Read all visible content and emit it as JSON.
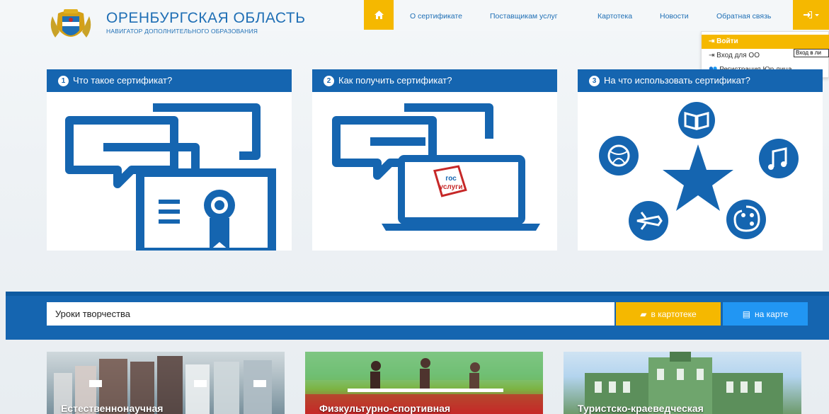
{
  "header": {
    "title": "ОРЕНБУРГСКАЯ ОБЛАСТЬ",
    "subtitle": "НАВИГАТОР ДОПОЛНИТЕЛЬНОГО ОБРАЗОВАНИЯ",
    "home_icon": "home-icon",
    "nav": [
      {
        "label": "О сертификате"
      },
      {
        "label": "Поставщикам услуг"
      },
      {
        "label": "Картотека"
      },
      {
        "label": "Новости"
      },
      {
        "label": "Обратная связь"
      }
    ],
    "login_icon": "sign-in-icon"
  },
  "login_menu": {
    "items": [
      {
        "label": "Войти",
        "icon": "sign-in-icon"
      },
      {
        "label": "Вход для ОО",
        "icon": "sign-in-icon"
      },
      {
        "label": "Регистрация Юр.лица",
        "icon": "user-add-icon"
      }
    ],
    "tooltip": "Вход в ли"
  },
  "cards": [
    {
      "num": "1",
      "title": "Что такое сертификат?"
    },
    {
      "num": "2",
      "title": "Как получить сертификат?",
      "logo_text_1": "гос",
      "logo_text_2": "услуги"
    },
    {
      "num": "3",
      "title": "На что использовать сертификат?"
    }
  ],
  "search": {
    "value": "Уроки творчества",
    "catalog_button": "в картотеке",
    "map_button": "на карте"
  },
  "categories": [
    {
      "label": "Естественнонаучная"
    },
    {
      "label": "Физкультурно-спортивная"
    },
    {
      "label": "Туристско-краеведческая"
    }
  ],
  "colors": {
    "primary": "#1565b0",
    "accent": "#f5b800",
    "map_button": "#2196f3"
  }
}
